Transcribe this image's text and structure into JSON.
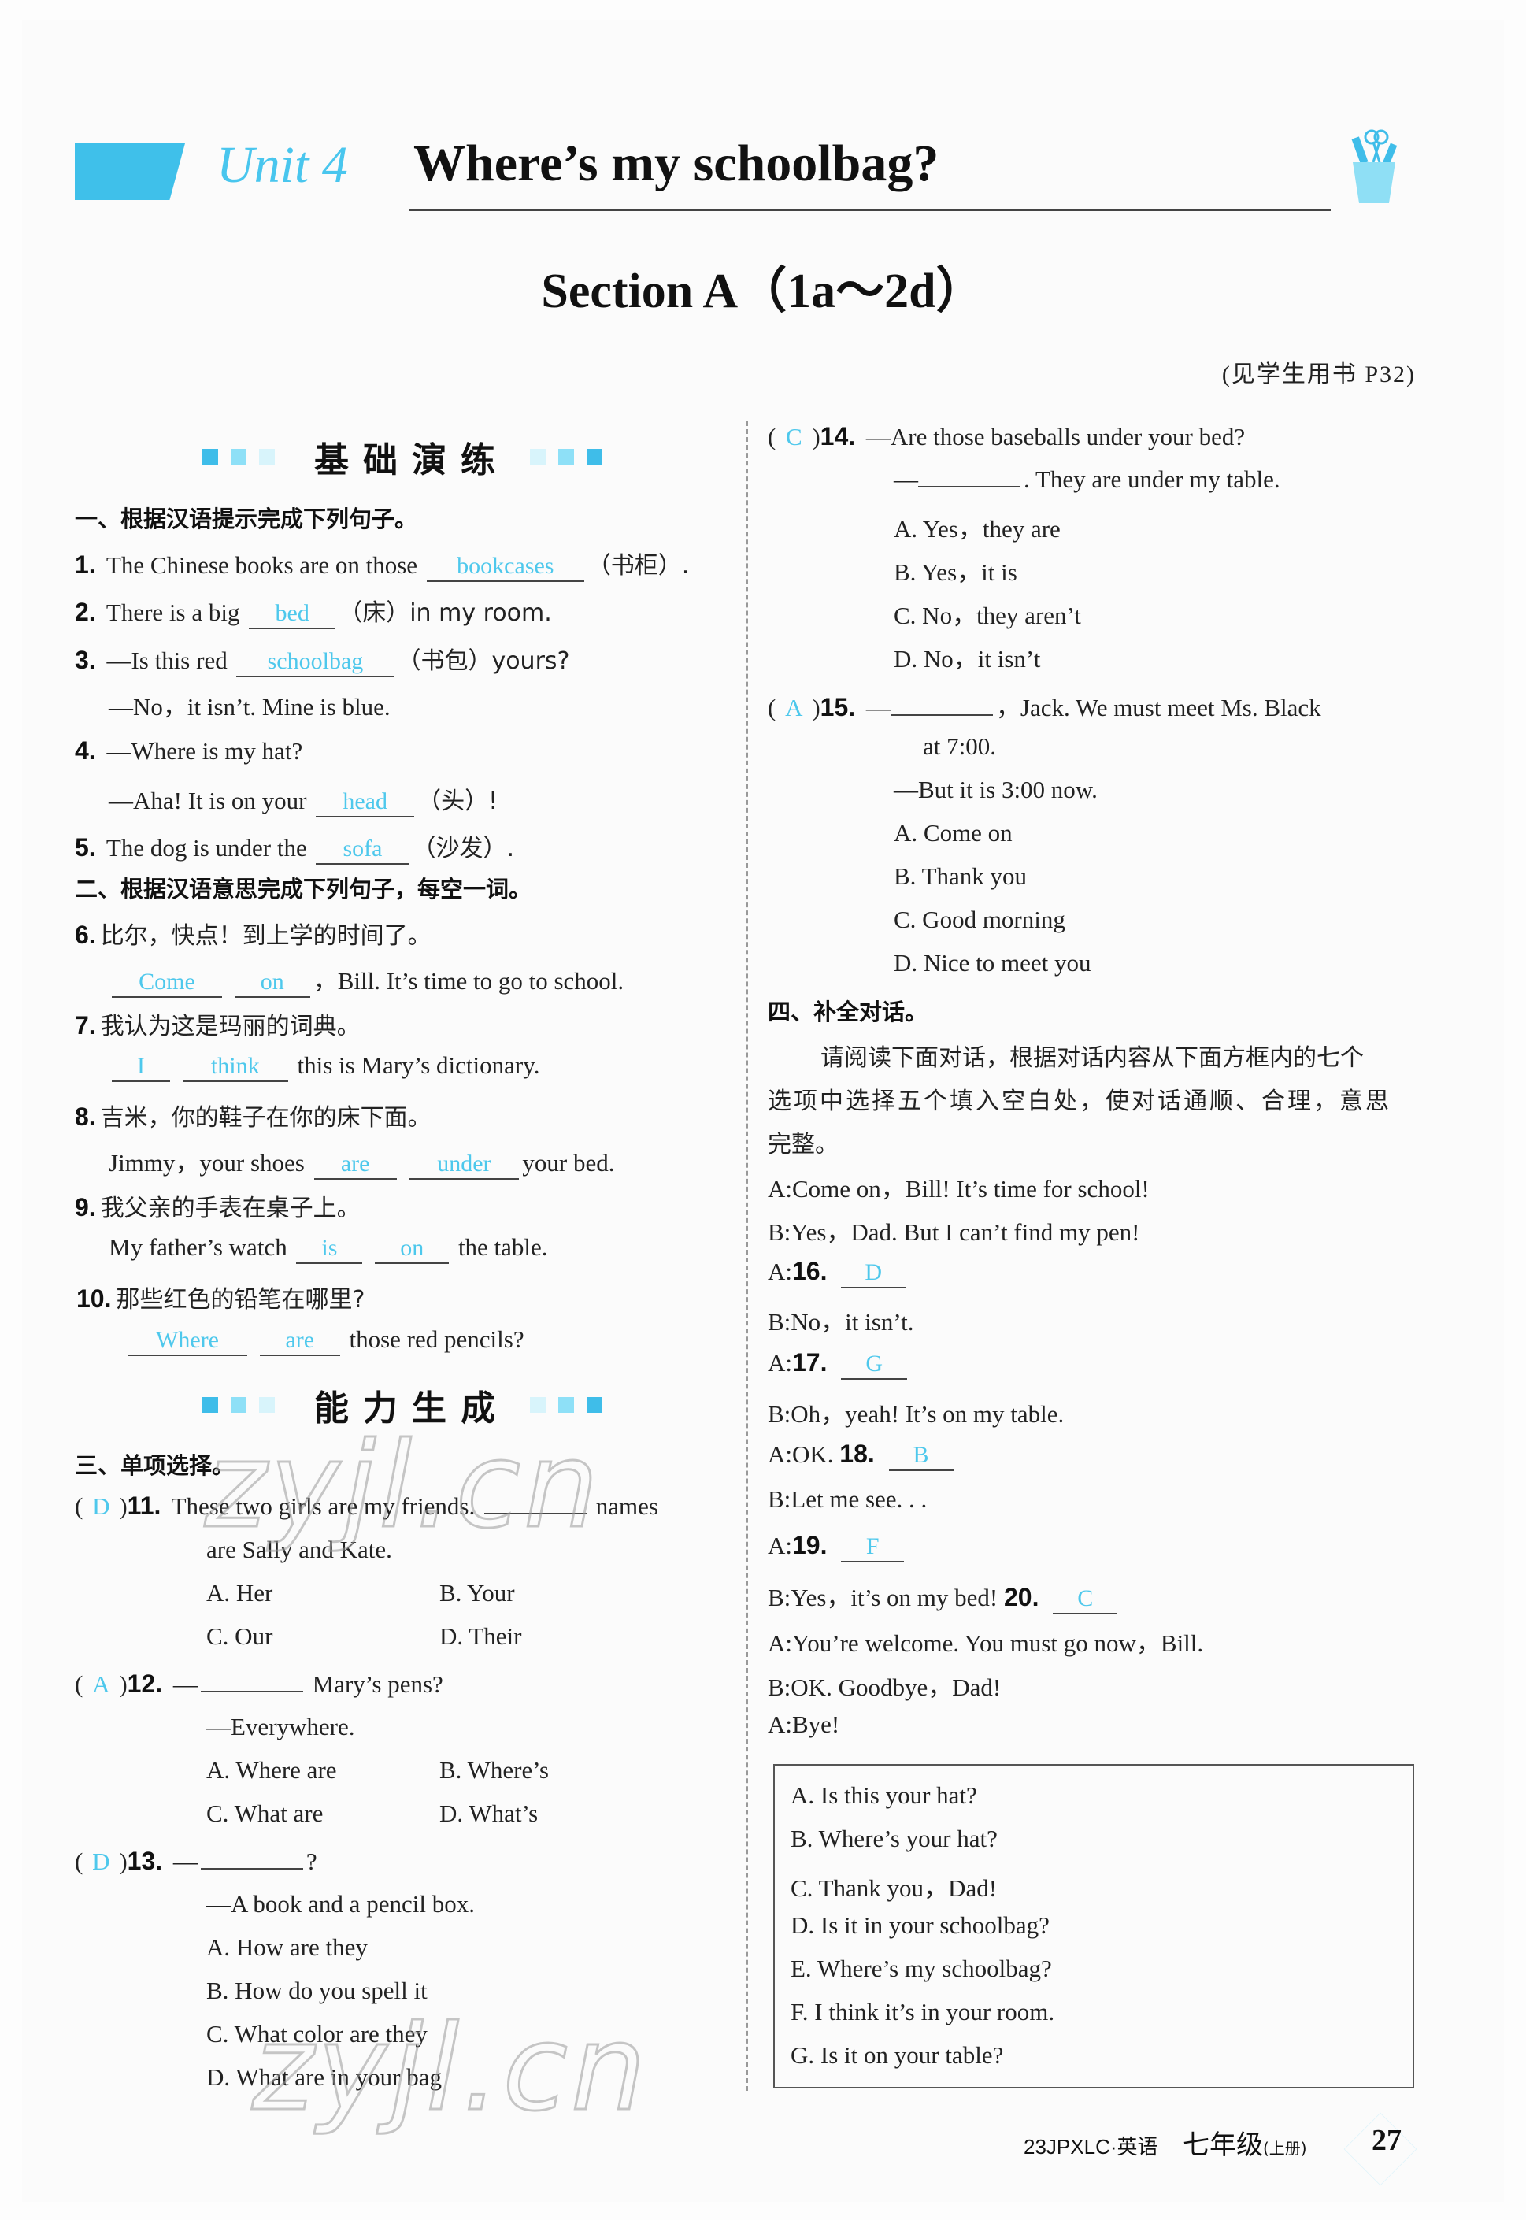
{
  "header": {
    "unit_label": "Unit 4",
    "unit_title": "Where’s my schoolbag?",
    "section_title": "Section A（1a～2d）",
    "reference_note": "(见学生用书 P32)",
    "accent_color": "#3fc0ea",
    "answer_color": "#4ec8ec"
  },
  "banners": {
    "basic": "基础演练",
    "ability": "能力生成"
  },
  "part1": {
    "heading": "一、根据汉语提示完成下列句子。",
    "items": [
      {
        "num": "1.",
        "before": "The Chinese books are on those",
        "answer": "bookcases",
        "after": "（书柜）."
      },
      {
        "num": "2.",
        "before": "There is a big",
        "answer": "bed",
        "after": "（床）in my room."
      },
      {
        "num": "3.",
        "before": "—Is this red",
        "answer": "schoolbag",
        "after": "（书包）yours?",
        "line2": "—No，it isn’t.  Mine is blue."
      },
      {
        "num": "4.",
        "before": "—Where is my hat?",
        "line2_before": "—Aha! It is on your",
        "answer": "head",
        "after": "（头）!"
      },
      {
        "num": "5.",
        "before": "The dog is under the",
        "answer": "sofa",
        "after": "（沙发）."
      }
    ]
  },
  "part2": {
    "heading": "二、根据汉语意思完成下列句子，每空一词。",
    "items": [
      {
        "num": "6.",
        "cn": "比尔，快点！到上学的时间了。",
        "answers": [
          "Come",
          "on"
        ],
        "after": "，Bill.  It’s time to go to school."
      },
      {
        "num": "7.",
        "cn": "我认为这是玛丽的词典。",
        "answers": [
          "I",
          "think"
        ],
        "after": "this is Mary’s dictionary."
      },
      {
        "num": "8.",
        "cn": "吉米，你的鞋子在你的床下面。",
        "before": "Jimmy，your shoes",
        "answers": [
          "are",
          "under"
        ],
        "after": "your bed."
      },
      {
        "num": "9.",
        "cn": "我父亲的手表在桌子上。",
        "before": "My father’s watch",
        "answers": [
          "is",
          "on"
        ],
        "after": "the table."
      },
      {
        "num": "10.",
        "cn": "那些红色的铅笔在哪里?",
        "answers": [
          "Where",
          "are"
        ],
        "after": "those red pencils?"
      }
    ]
  },
  "part3": {
    "heading": "三、单项选择。",
    "items": [
      {
        "num": "11.",
        "answer": "D",
        "line1": "These two girls are my friends.",
        "line1_after": "names",
        "line2": "are Sally and Kate.",
        "options": [
          "A. Her",
          "B. Your",
          "C. Our",
          "D. Their"
        ]
      },
      {
        "num": "12.",
        "answer": "A",
        "line1": "—",
        "line1_after": "Mary’s pens?",
        "line2": "—Everywhere.",
        "options": [
          "A. Where are",
          "B. Where’s",
          "C. What are",
          "D. What’s"
        ]
      },
      {
        "num": "13.",
        "answer": "D",
        "line1": "—",
        "line1_after": "?",
        "line2": "—A book and a pencil box.",
        "options": [
          "A. How are they",
          "B. How do you spell it",
          "C. What color are they",
          "D. What are in your bag"
        ]
      },
      {
        "num": "14.",
        "answer": "C",
        "line1": "—Are those baseballs under your bed?",
        "line2_after": ".  They are under my table.",
        "options": [
          "A. Yes，they are",
          "B. Yes，it is",
          "C. No，they aren’t",
          "D. No，it isn’t"
        ]
      },
      {
        "num": "15.",
        "answer": "A",
        "line1_after": "，Jack.  We must meet Ms.  Black",
        "line1b": "at 7:00.",
        "line2": "—But it is 3:00 now.",
        "options": [
          "A. Come on",
          "B. Thank you",
          "C. Good morning",
          "D. Nice to meet you"
        ]
      }
    ]
  },
  "part4": {
    "heading": "四、补全对话。",
    "instructions": [
      "请阅读下面对话，根据对话内容从下面方框内的七个",
      "选项中选择五个填入空白处，使对话通顺、合理，意思",
      "完整。"
    ],
    "dialogue": [
      {
        "text": "A:Come on，Bill! It’s time for school!"
      },
      {
        "text": "B:Yes，Dad. But I can’t find my pen!"
      },
      {
        "prefix": "A:",
        "num": "16.",
        "answer": "D"
      },
      {
        "text": "B:No，it isn’t."
      },
      {
        "prefix": "A:",
        "num": "17.",
        "answer": "G"
      },
      {
        "text": "B:Oh，yeah! It’s on my table."
      },
      {
        "prefix": "A:OK.",
        "num": "18.",
        "answer": "B"
      },
      {
        "text": "B:Let me see. . ."
      },
      {
        "prefix": "A:",
        "num": "19.",
        "answer": "F"
      },
      {
        "prefix": "B:Yes，it’s on my bed!",
        "num": "20.",
        "answer": "C"
      },
      {
        "text": "A:You’re welcome.  You must go now，Bill."
      },
      {
        "text": "B:OK.  Goodbye，Dad!"
      },
      {
        "text": "A:Bye!"
      }
    ],
    "options": [
      "A. Is this your hat?",
      "B. Where’s your hat?",
      "C. Thank you，Dad!",
      "D. Is it in your schoolbag?",
      "E. Where’s my schoolbag?",
      "F. I think it’s in your room.",
      "G. Is it on your table?"
    ]
  },
  "footer": {
    "code": "23JPXLC·英语",
    "grade": "七年级",
    "volume": "(上册)",
    "page_number": "27"
  },
  "watermark": "zyjl.cn"
}
